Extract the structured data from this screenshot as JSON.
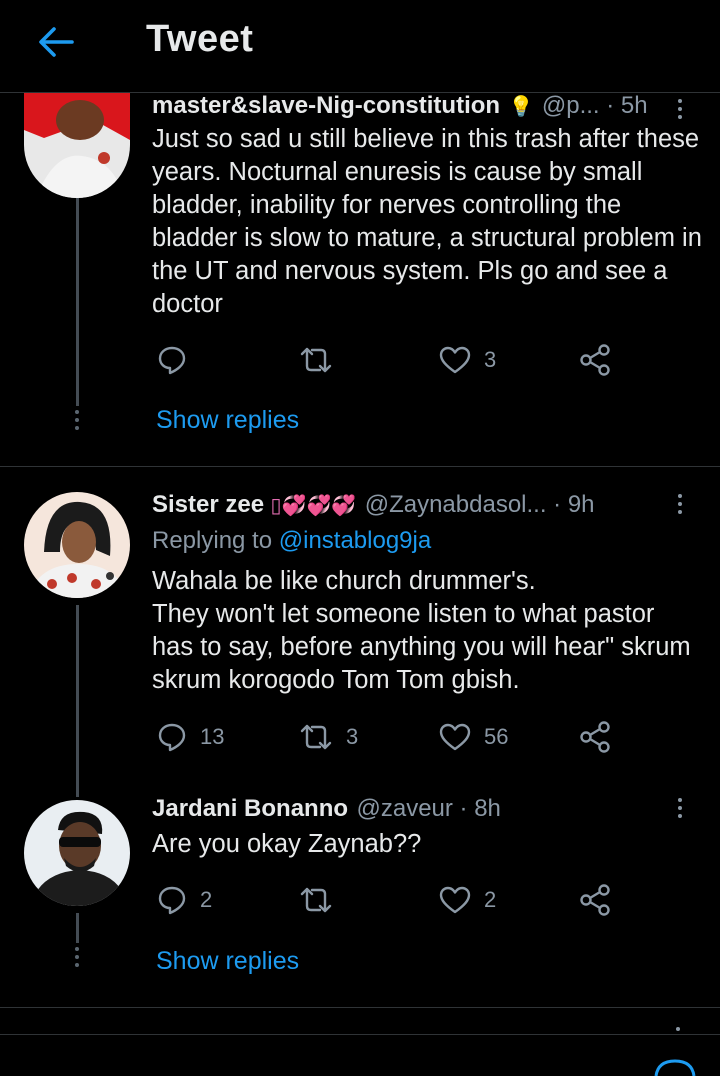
{
  "header": {
    "title": "Tweet"
  },
  "colors": {
    "accent": "#1d9bf0",
    "muted": "#8b98a5",
    "text": "#e7e9ea",
    "background": "#000000"
  },
  "tweets": [
    {
      "name": "master&slave-Nig-constitution",
      "badge": "💡",
      "meta": "@p... · 5h",
      "body": "Just so sad u still believe in this trash after these years. Nocturnal enuresis is cause by small bladder, inability for nerves controlling the bladder is slow to mature, a structural problem in the UT and nervous system. Pls go and see a doctor",
      "counts": {
        "replies": "",
        "retweets": "",
        "likes": "3"
      },
      "show_replies": "Show replies"
    },
    {
      "name": "Sister zee",
      "badge": "▯💞💞💞",
      "meta": "@Zaynabdasol... · 9h",
      "replying_prefix": "Replying to",
      "replying_handle": "@instablog9ja",
      "body": "Wahala be like church drummer's.\n They won't let someone listen to what pastor has to say, before anything you will hear\" skrum skrum korogodo Tom Tom gbish.",
      "counts": {
        "replies": "13",
        "retweets": "3",
        "likes": "56"
      }
    },
    {
      "name": "Jardani Bonanno",
      "meta": "@zaveur · 8h",
      "body": "Are you okay Zaynab??",
      "counts": {
        "replies": "2",
        "retweets": "",
        "likes": "2"
      },
      "show_replies": "Show replies"
    }
  ],
  "icons": {
    "back": "arrow-left-icon",
    "reply": "reply-icon",
    "retweet": "retweet-icon",
    "like": "heart-icon",
    "share": "share-icon",
    "more": "more-vertical-icon"
  }
}
